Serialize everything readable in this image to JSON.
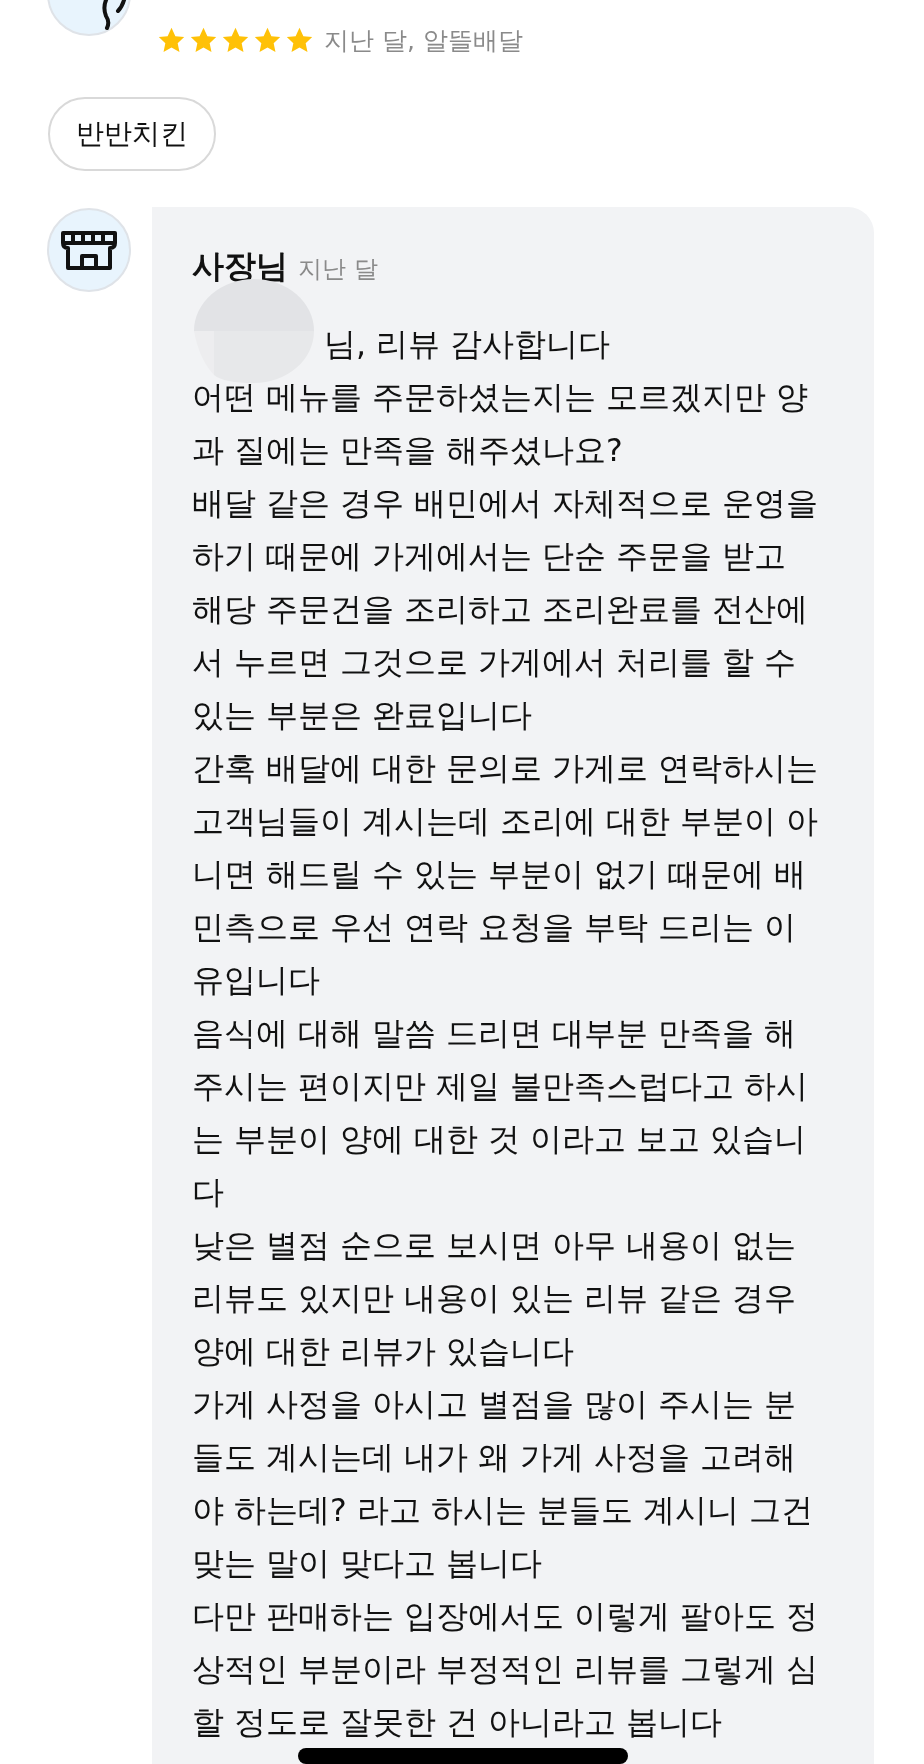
{
  "review": {
    "stars": 5,
    "meta": "지난 달, 알뜰배달",
    "menu_chip": "반반치킨"
  },
  "reply": {
    "author": "사장님",
    "time": "지난 달",
    "paragraphs": [
      "님,  리뷰 감사합니다",
      "어떤 메뉴를 주문하셨는지는 모르겠지만 양과 질에는 만족을 해주셨나요?",
      "배달 같은 경우 배민에서 자체적으로 운영을 하기 때문에 가게에서는 단순 주문을 받고 해당 주문건을 조리하고 조리완료를 전산에서 누르면 그것으로 가게에서 처리를 할 수 있는 부분은 완료입니다",
      "간혹 배달에 대한 문의로 가게로 연락하시는 고객님들이 계시는데 조리에 대한 부분이 아니면 해드릴 수 있는 부분이 없기 때문에 배민측으로 우선 연락 요청을 부탁 드리는 이유입니다",
      "음식에 대해 말씀 드리면 대부분 만족을 해주시는 편이지만 제일 불만족스럽다고 하시는 부분이 양에 대한 것 이라고 보고 있습니다",
      "낮은 별점 순으로 보시면 아무 내용이 없는 리뷰도 있지만 내용이 있는 리뷰 같은 경우 양에 대한 리뷰가 있습니다",
      "가게 사정을 아시고 별점을 많이 주시는 분들도 계시는데 내가 왜 가게 사정을 고려해야 하는데? 라고 하시는 분들도 계시니 그건 맞는 말이 맞다고 봅니다",
      "다만 판매하는 입장에서도 이렇게 팔아도 정상적인 부분이라 부정적인 리뷰를 그렇게 심할 정도로 잘못한 건 아니라고 봅니다"
    ]
  }
}
